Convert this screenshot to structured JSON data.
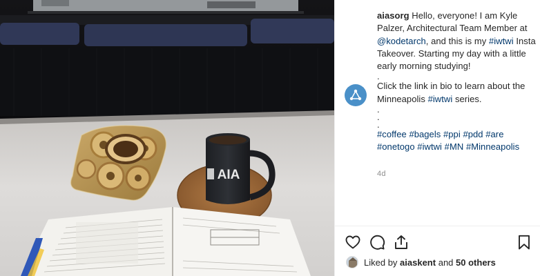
{
  "post": {
    "username": "aiasorg",
    "caption_intro": " Hello, everyone! I am Kyle Palzer, Architectural Team Member at ",
    "mention": "@kodetarch",
    "caption_mid": ", and this is my ",
    "hashtag_iwtwi": "#iwtwi",
    "caption_after": " Insta Takeover. Starting my day with a little early morning studying!",
    "dot": ".",
    "bio_line": "Click the link in bio to learn about the Minneapolis ",
    "bio_hashtag": "#iwtwi",
    "bio_end": " series.",
    "hashtags": [
      "#coffee",
      "#bagels",
      "#ppi",
      "#pdd",
      "#are",
      "#onetogo",
      "#iwtwi",
      "#MN",
      "#Minneapolis"
    ],
    "age": "4d"
  },
  "likes": {
    "prefix": "Liked by ",
    "user": "aiaskent",
    "middle": " and ",
    "count": "50 others"
  },
  "mug_text": "AIA",
  "colors": {
    "link": "#00376b",
    "text": "#262626",
    "muted": "#8e8e8e",
    "avatar": "#4a90c8"
  },
  "icons": [
    "heart-icon",
    "comment-icon",
    "share-icon",
    "bookmark-icon",
    "aia-logo-icon"
  ]
}
